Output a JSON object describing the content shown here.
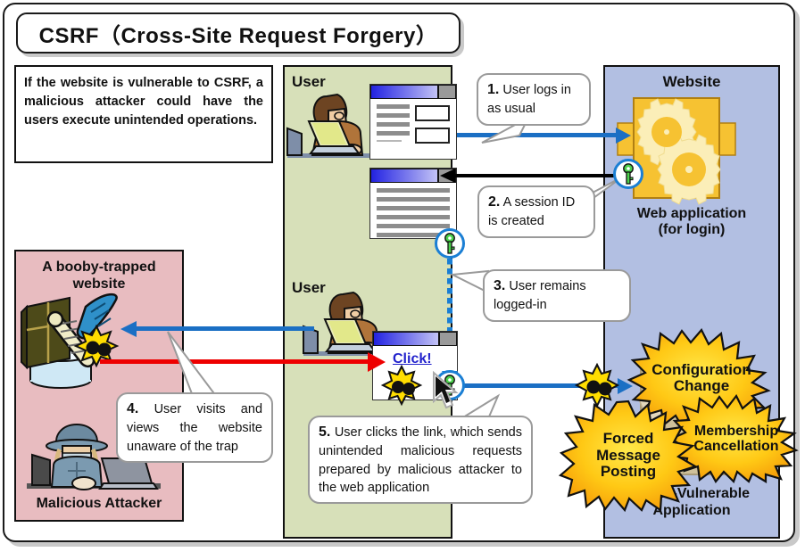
{
  "title": "CSRF（Cross-Site Request Forgery）",
  "intro": "If the website is vulnerable to CSRF, a malicious attacker could have the users execute unintended operations.",
  "panels": {
    "user_top_label": "User",
    "user_bottom_label": "User",
    "website_label": "Website",
    "webapp_label_line1": "Web application",
    "webapp_label_line2": "(for login)",
    "csrf_app_label_line1": "CSRF-Vulnerable",
    "csrf_app_label_line2": "Application",
    "trap_site_label_line1": "A booby-trapped",
    "trap_site_label_line2": "website",
    "attacker_label": "Malicious Attacker"
  },
  "click_link": "Click!",
  "callouts": [
    {
      "num": "1.",
      "text": "User logs in as usual"
    },
    {
      "num": "2.",
      "text": "A session ID is created"
    },
    {
      "num": "3.",
      "text": "User remains logged-in"
    },
    {
      "num": "4.",
      "text": "User visits and views the website unaware of the trap"
    },
    {
      "num": "5.",
      "text": "User clicks the link, which sends unintended malicious requests prepared by malicious attacker to the web application"
    }
  ],
  "bursts": [
    {
      "line1": "Configuration",
      "line2": "Change"
    },
    {
      "line1": "Membership",
      "line2": "Cancellation"
    },
    {
      "line1": "Forced",
      "line2": "Message",
      "line3": "Posting"
    }
  ],
  "colors": {
    "panel_green": "#d7e0b9",
    "panel_blue": "#b2bfe2",
    "panel_pink": "#e8bcc0",
    "arrow_blue": "#1b6fc4",
    "arrow_red": "#ee0000",
    "arrow_black": "#000000",
    "burst_yellow": "#ffe000",
    "burst_orange": "#f5a311",
    "app_yellow": "#f6c232",
    "key_green": "#4cd24c",
    "link_blue": "#2222cc"
  }
}
